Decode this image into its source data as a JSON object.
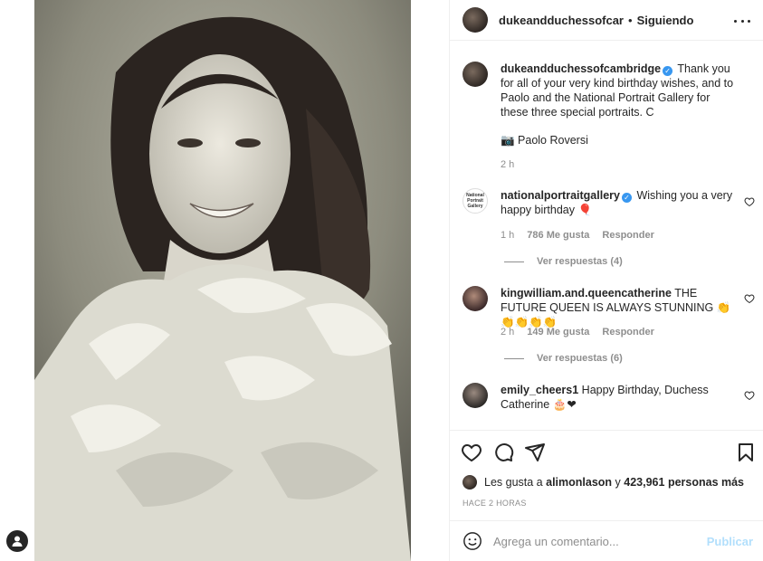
{
  "post": {
    "author": "dukeandduchessofcar",
    "separator": "•",
    "follow_state": "Siguiendo"
  },
  "caption": {
    "author": "dukeandduchessofcambridge",
    "text": "Thank you for all of your very kind birthday wishes, and to Paolo and the National Portrait Gallery for these three special portraits. C",
    "credit": "📷 Paolo Roversi",
    "time": "2 h"
  },
  "comments": [
    {
      "author": "nationalportraitgallery",
      "logo_text": "National Portrait Gallery",
      "text": "Wishing you a very happy birthday 🎈",
      "time": "1 h",
      "likes": "786 Me gusta",
      "reply": "Responder",
      "view_replies": "Ver respuestas (4)"
    },
    {
      "author": "kingwilliam.and.queencatherine",
      "text": "THE FUTURE QUEEN IS ALWAYS STUNNING 👏👏👏👏👏",
      "time": "2 h",
      "likes": "149 Me gusta",
      "reply": "Responder",
      "view_replies": "Ver respuestas (6)"
    },
    {
      "author": "emily_cheers1",
      "text": "Happy Birthday, Duchess Catherine 🎂❤"
    }
  ],
  "likes_line": {
    "prefix": "Les gusta a",
    "user": "alimonlason",
    "middle": "y",
    "count": "423,961 personas más"
  },
  "timestamp": "HACE 2 HORAS",
  "composer": {
    "placeholder": "Agrega un comentario...",
    "post_label": "Publicar"
  },
  "colors": {
    "verified": "#3897f0",
    "post_disabled": "#b2dffc",
    "muted": "#8e8e8e"
  }
}
